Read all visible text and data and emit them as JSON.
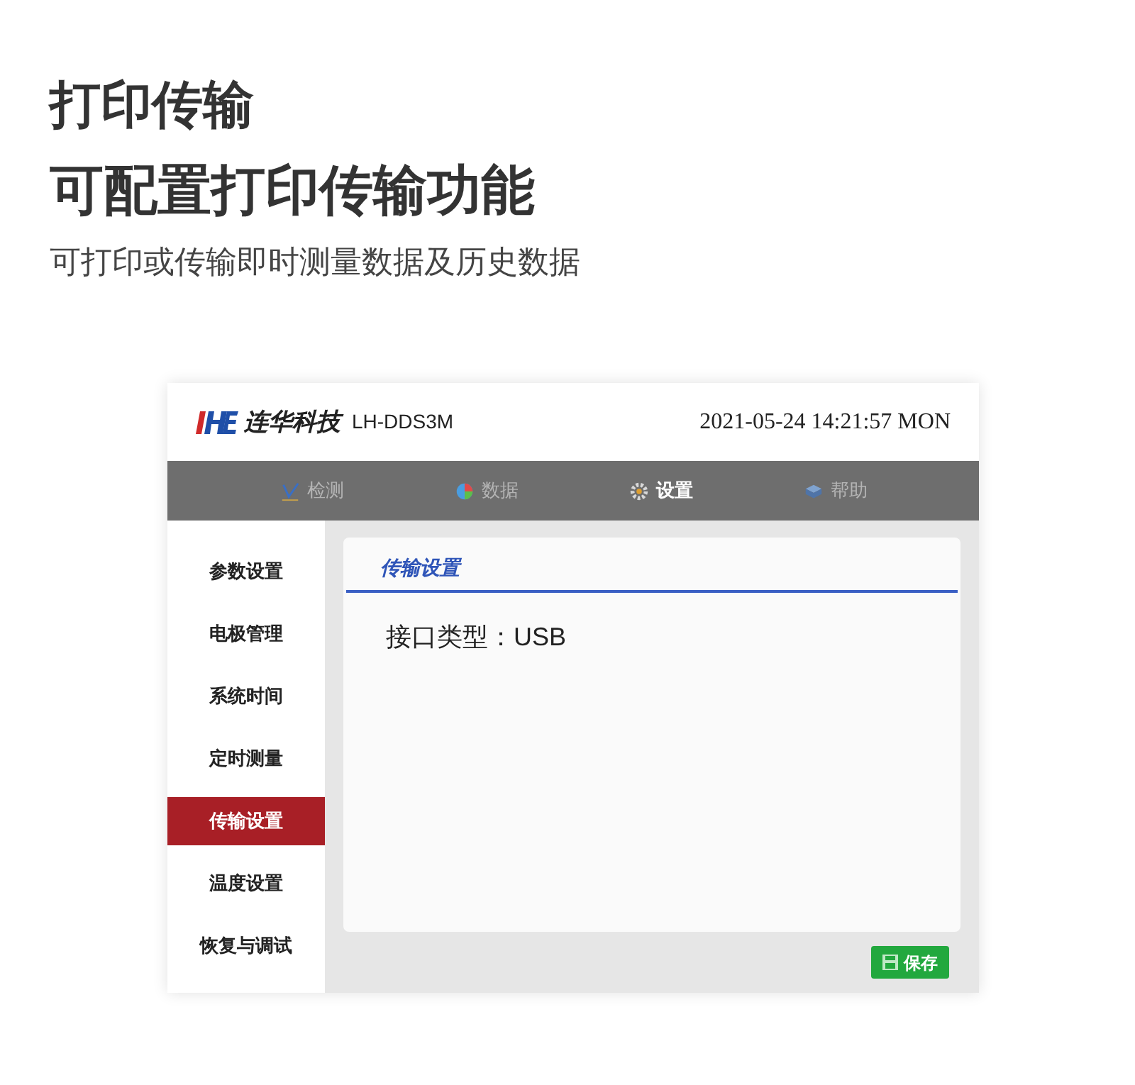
{
  "headline": "打印传输",
  "subheadline": "可配置打印传输功能",
  "description": "可打印或传输即时测量数据及历史数据",
  "device": {
    "brand": "连华科技",
    "model": "LH-DDS3M",
    "datetime": "2021-05-24 14:21:57 MON",
    "tabs": [
      {
        "label": "检测",
        "selected": false
      },
      {
        "label": "数据",
        "selected": false
      },
      {
        "label": "设置",
        "selected": true
      },
      {
        "label": "帮助",
        "selected": false
      }
    ],
    "sidebar": [
      {
        "label": "参数设置",
        "selected": false
      },
      {
        "label": "电极管理",
        "selected": false
      },
      {
        "label": "系统时间",
        "selected": false
      },
      {
        "label": "定时测量",
        "selected": false
      },
      {
        "label": "传输设置",
        "selected": true
      },
      {
        "label": "温度设置",
        "selected": false
      },
      {
        "label": "恢复与调试",
        "selected": false
      }
    ],
    "panel": {
      "title": "传输设置",
      "field": "接口类型：USB"
    },
    "save_button": "保存"
  }
}
